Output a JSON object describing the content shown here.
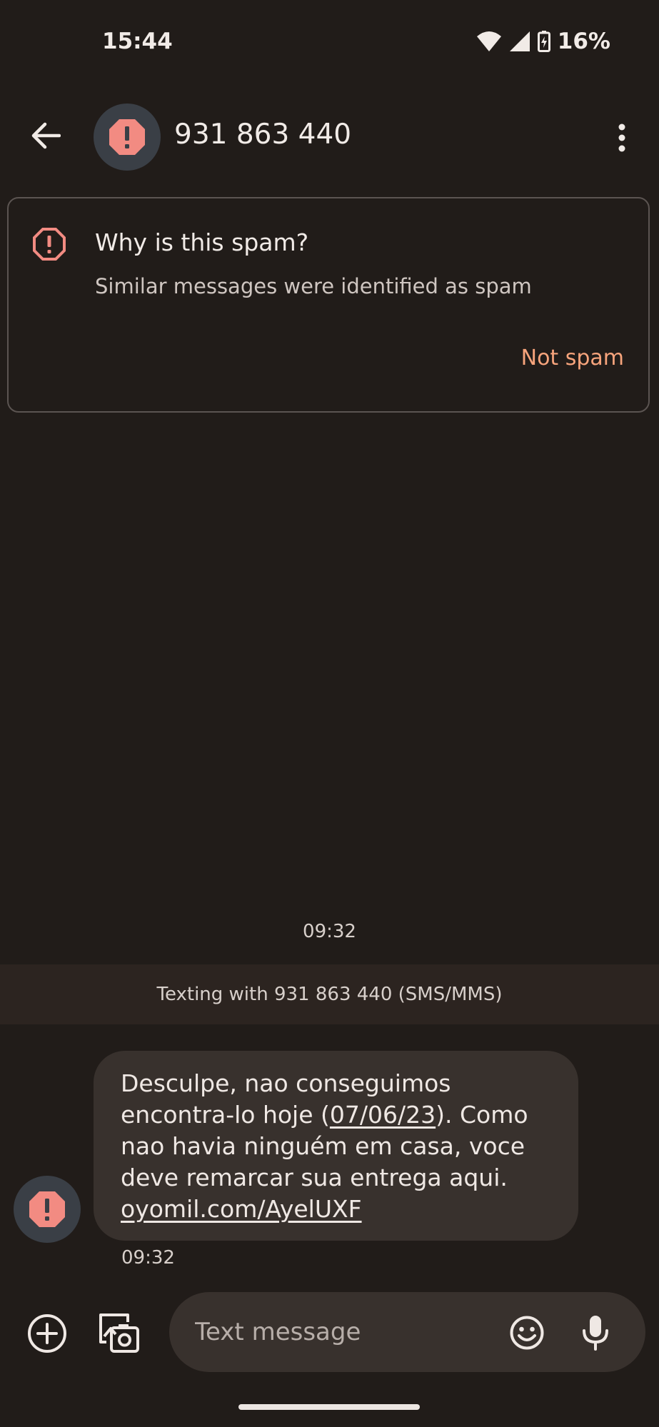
{
  "status_bar": {
    "time": "15:44",
    "battery_percent": "16%",
    "icons": [
      "wifi-icon",
      "cell-signal-icon",
      "battery-charging-icon"
    ]
  },
  "header": {
    "contact": "931 863 440",
    "icons": [
      "back-arrow-icon",
      "spam-warning-icon",
      "more-vert-icon"
    ]
  },
  "spam_card": {
    "title": "Why is this spam?",
    "subtitle": "Similar messages were identified as spam",
    "action": "Not spam"
  },
  "conversation": {
    "date_divider": "09:32",
    "banner": "Texting with 931 863 440 (SMS/MMS)",
    "messages": [
      {
        "line1": "Desculpe, nao conseguimos",
        "line2_pre": "encontra-lo hoje (",
        "line2_date": "07/06/23",
        "line2_post": "). Como",
        "line3": "nao havia ninguém em casa, voce",
        "line4": "deve remarcar sua entrega aqui.",
        "link": "oyomil.com/AyelUXF",
        "time": "09:32"
      }
    ]
  },
  "compose": {
    "placeholder": "Text message",
    "icons": [
      "add-circle-icon",
      "gallery-icon",
      "emoji-icon",
      "mic-icon"
    ]
  },
  "colors": {
    "background": "#211c19",
    "accent": "#f7a47c",
    "spam_red": "#f28b82",
    "bubble": "#38312d"
  }
}
